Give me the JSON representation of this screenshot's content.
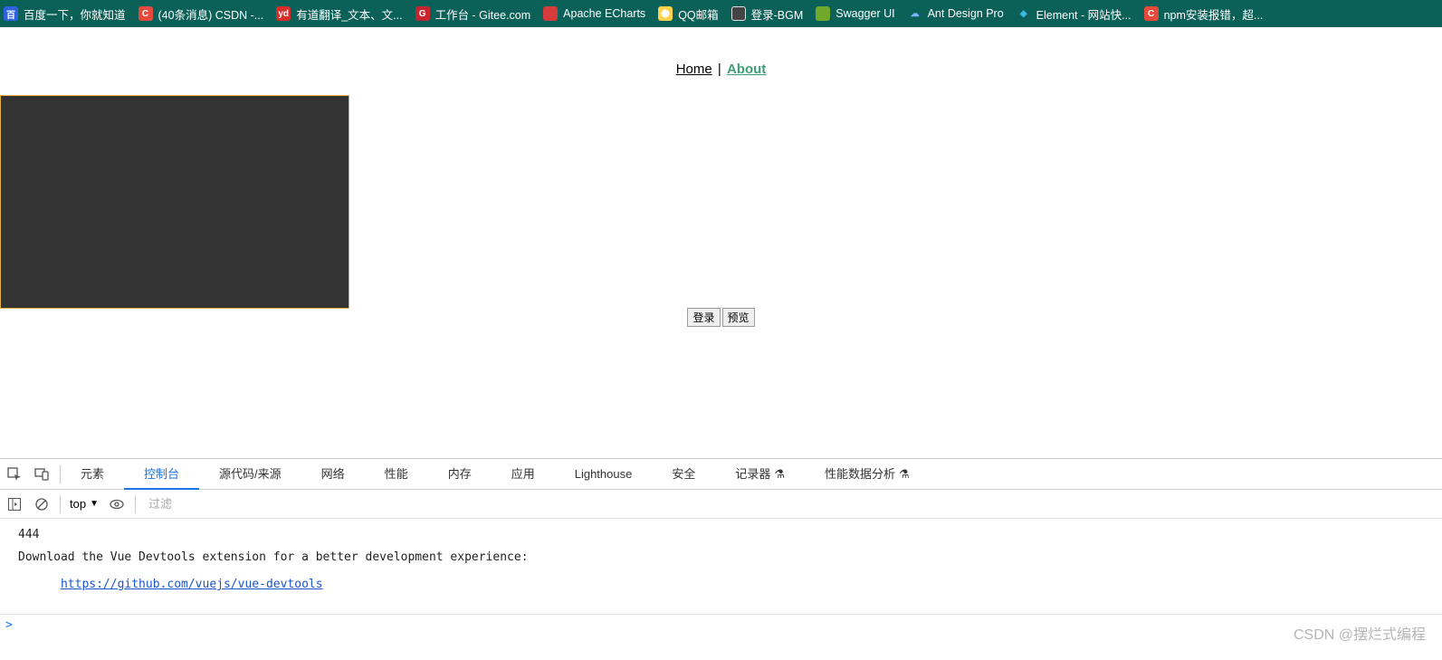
{
  "bookmarks": [
    {
      "label": "百度一下，你就知道",
      "iconClass": "fi-baidu",
      "iconText": "百"
    },
    {
      "label": "(40条消息) CSDN -...",
      "iconClass": "fi-csdn",
      "iconText": "C"
    },
    {
      "label": "有道翻译_文本、文...",
      "iconClass": "fi-yd",
      "iconText": "yd"
    },
    {
      "label": "工作台 - Gitee.com",
      "iconClass": "fi-gitee",
      "iconText": "G"
    },
    {
      "label": "Apache ECharts",
      "iconClass": "fi-echarts",
      "iconText": ""
    },
    {
      "label": "QQ邮箱",
      "iconClass": "fi-qq",
      "iconText": ""
    },
    {
      "label": "登录-BGM",
      "iconClass": "fi-globe",
      "iconText": ""
    },
    {
      "label": "Swagger UI",
      "iconClass": "fi-swagger",
      "iconText": ""
    },
    {
      "label": "Ant Design Pro",
      "iconClass": "fi-ant",
      "iconText": "☁"
    },
    {
      "label": "Element - 网站快...",
      "iconClass": "fi-element",
      "iconText": "◆"
    },
    {
      "label": "npm安装报错，超...",
      "iconClass": "fi-npm",
      "iconText": "C"
    }
  ],
  "nav": {
    "home": "Home",
    "sep": "|",
    "about": "About"
  },
  "buttons": {
    "login": "登录",
    "preview": "预览"
  },
  "devtools": {
    "tabs": {
      "elements": "元素",
      "console": "控制台",
      "sources": "源代码/来源",
      "network": "网络",
      "performance": "性能",
      "memory": "内存",
      "application": "应用",
      "lighthouse": "Lighthouse",
      "security": "安全",
      "recorder": "记录器",
      "perfInsights": "性能数据分析"
    },
    "beta": "⚗",
    "toolbar": {
      "topLabel": "top",
      "filterPlaceholder": "过滤"
    },
    "log": {
      "l1": "444",
      "l2": "Download the Vue Devtools extension for a better development experience:",
      "link": "https://github.com/vuejs/vue-devtools"
    },
    "prompt": ">"
  },
  "watermark": "CSDN @摆烂式编程"
}
